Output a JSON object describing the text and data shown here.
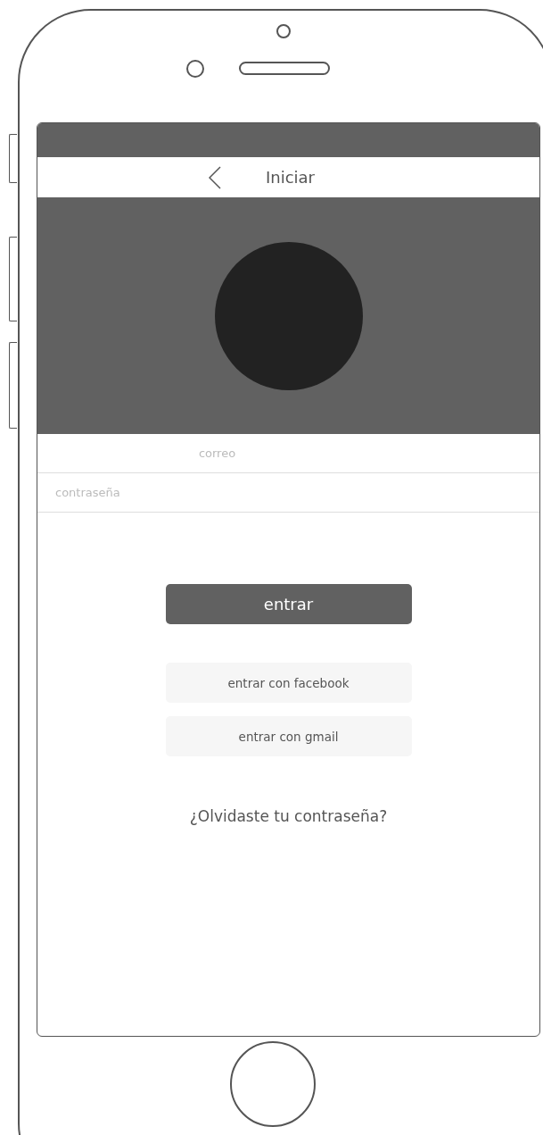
{
  "nav": {
    "title": "Iniciar"
  },
  "fields": [
    {
      "placeholder": "correo",
      "kind": "centered"
    },
    {
      "placeholder": "contraseña",
      "kind": "plain"
    }
  ],
  "primary_button": "entrar",
  "social_buttons": [
    "entrar con facebook",
    "entrar con gmail"
  ],
  "forgot_link": "¿Olvidaste tu contraseña?"
}
